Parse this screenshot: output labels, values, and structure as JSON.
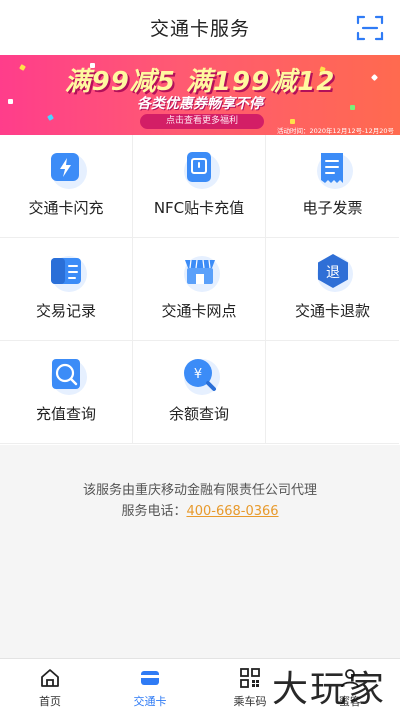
{
  "header": {
    "title": "交通卡服务",
    "scan_icon": "scan-icon"
  },
  "banner": {
    "headline": "满99减5 满199减12",
    "subline": "各类优惠券畅享不停",
    "button_label": "点击查看更多福利",
    "time_text": "活动时间：2020年12月12号-12月20号",
    "colors": {
      "start": "#ff3d8b",
      "end": "#ff6a4f"
    }
  },
  "services": [
    {
      "label": "交通卡闪充",
      "icon": "flash-charge-icon"
    },
    {
      "label": "NFC贴卡充值",
      "icon": "nfc-card-icon"
    },
    {
      "label": "电子发票",
      "icon": "invoice-icon"
    },
    {
      "label": "交易记录",
      "icon": "transaction-record-icon"
    },
    {
      "label": "交通卡网点",
      "icon": "service-outlet-icon"
    },
    {
      "label": "交通卡退款",
      "icon": "refund-icon"
    },
    {
      "label": "充值查询",
      "icon": "recharge-query-icon"
    },
    {
      "label": "余额查询",
      "icon": "balance-query-icon"
    }
  ],
  "info": {
    "agency_text": "该服务由重庆移动金融有限责任公司代理",
    "phone_label": "服务电话：",
    "phone_number": "400-668-0366"
  },
  "tabbar": {
    "active": "交通卡",
    "tabs": [
      {
        "label": "首页",
        "icon": "home-icon"
      },
      {
        "label": "交通卡",
        "icon": "card-icon"
      },
      {
        "label": "乘车码",
        "icon": "qr-code-icon"
      },
      {
        "label": "蜜客",
        "icon": "user-icon"
      }
    ]
  },
  "watermark": "大玩家",
  "accent_color": "#2f7bf5"
}
